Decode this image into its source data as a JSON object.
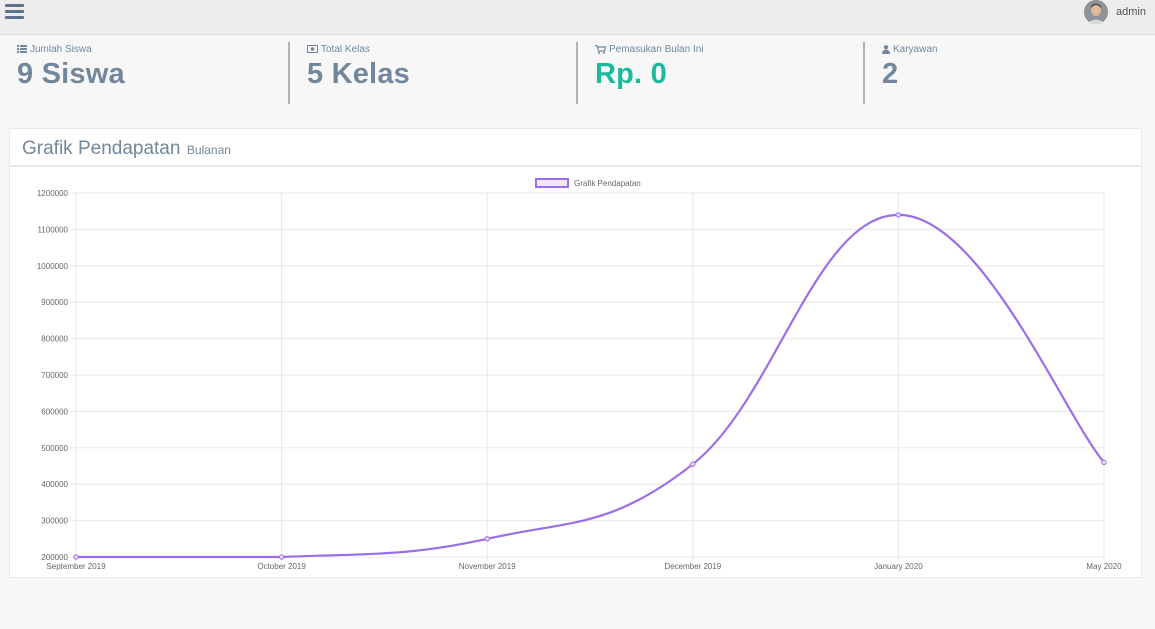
{
  "header": {
    "menu_icon": "hamburger-icon",
    "user_name": "admin",
    "avatar_icon": "user-avatar"
  },
  "tiles": [
    {
      "icon": "list-icon",
      "label": "Jumlah Siswa",
      "value": "9 Siswa",
      "color": "#73879c"
    },
    {
      "icon": "money-icon",
      "label": "Total Kelas",
      "value": "5 Kelas",
      "color": "#73879c"
    },
    {
      "icon": "cart-icon",
      "label": "Pemasukan Bulan Ini",
      "value": "Rp. 0",
      "color": "#1abb9c"
    },
    {
      "icon": "user-icon",
      "label": "Karyawan",
      "value": "2",
      "color": "#73879c"
    }
  ],
  "panel": {
    "title": "Grafik Pendapatan",
    "subtitle": "Bulanan"
  },
  "chart_data": {
    "type": "line",
    "title": "",
    "xlabel": "",
    "ylabel": "",
    "categories": [
      "September 2019",
      "October 2019",
      "November 2019",
      "December 2019",
      "January 2020",
      "May 2020"
    ],
    "series": [
      {
        "name": "Grafik Pendapatan",
        "values": [
          200000,
          200000,
          250000,
          455000,
          1140000,
          460000
        ],
        "color": "#9b6ee8"
      }
    ],
    "ylim": [
      200000,
      1200000
    ],
    "yticks": [
      200000,
      300000,
      400000,
      500000,
      600000,
      700000,
      800000,
      900000,
      1000000,
      1100000,
      1200000
    ],
    "grid": true,
    "legend_position": "top-center"
  }
}
